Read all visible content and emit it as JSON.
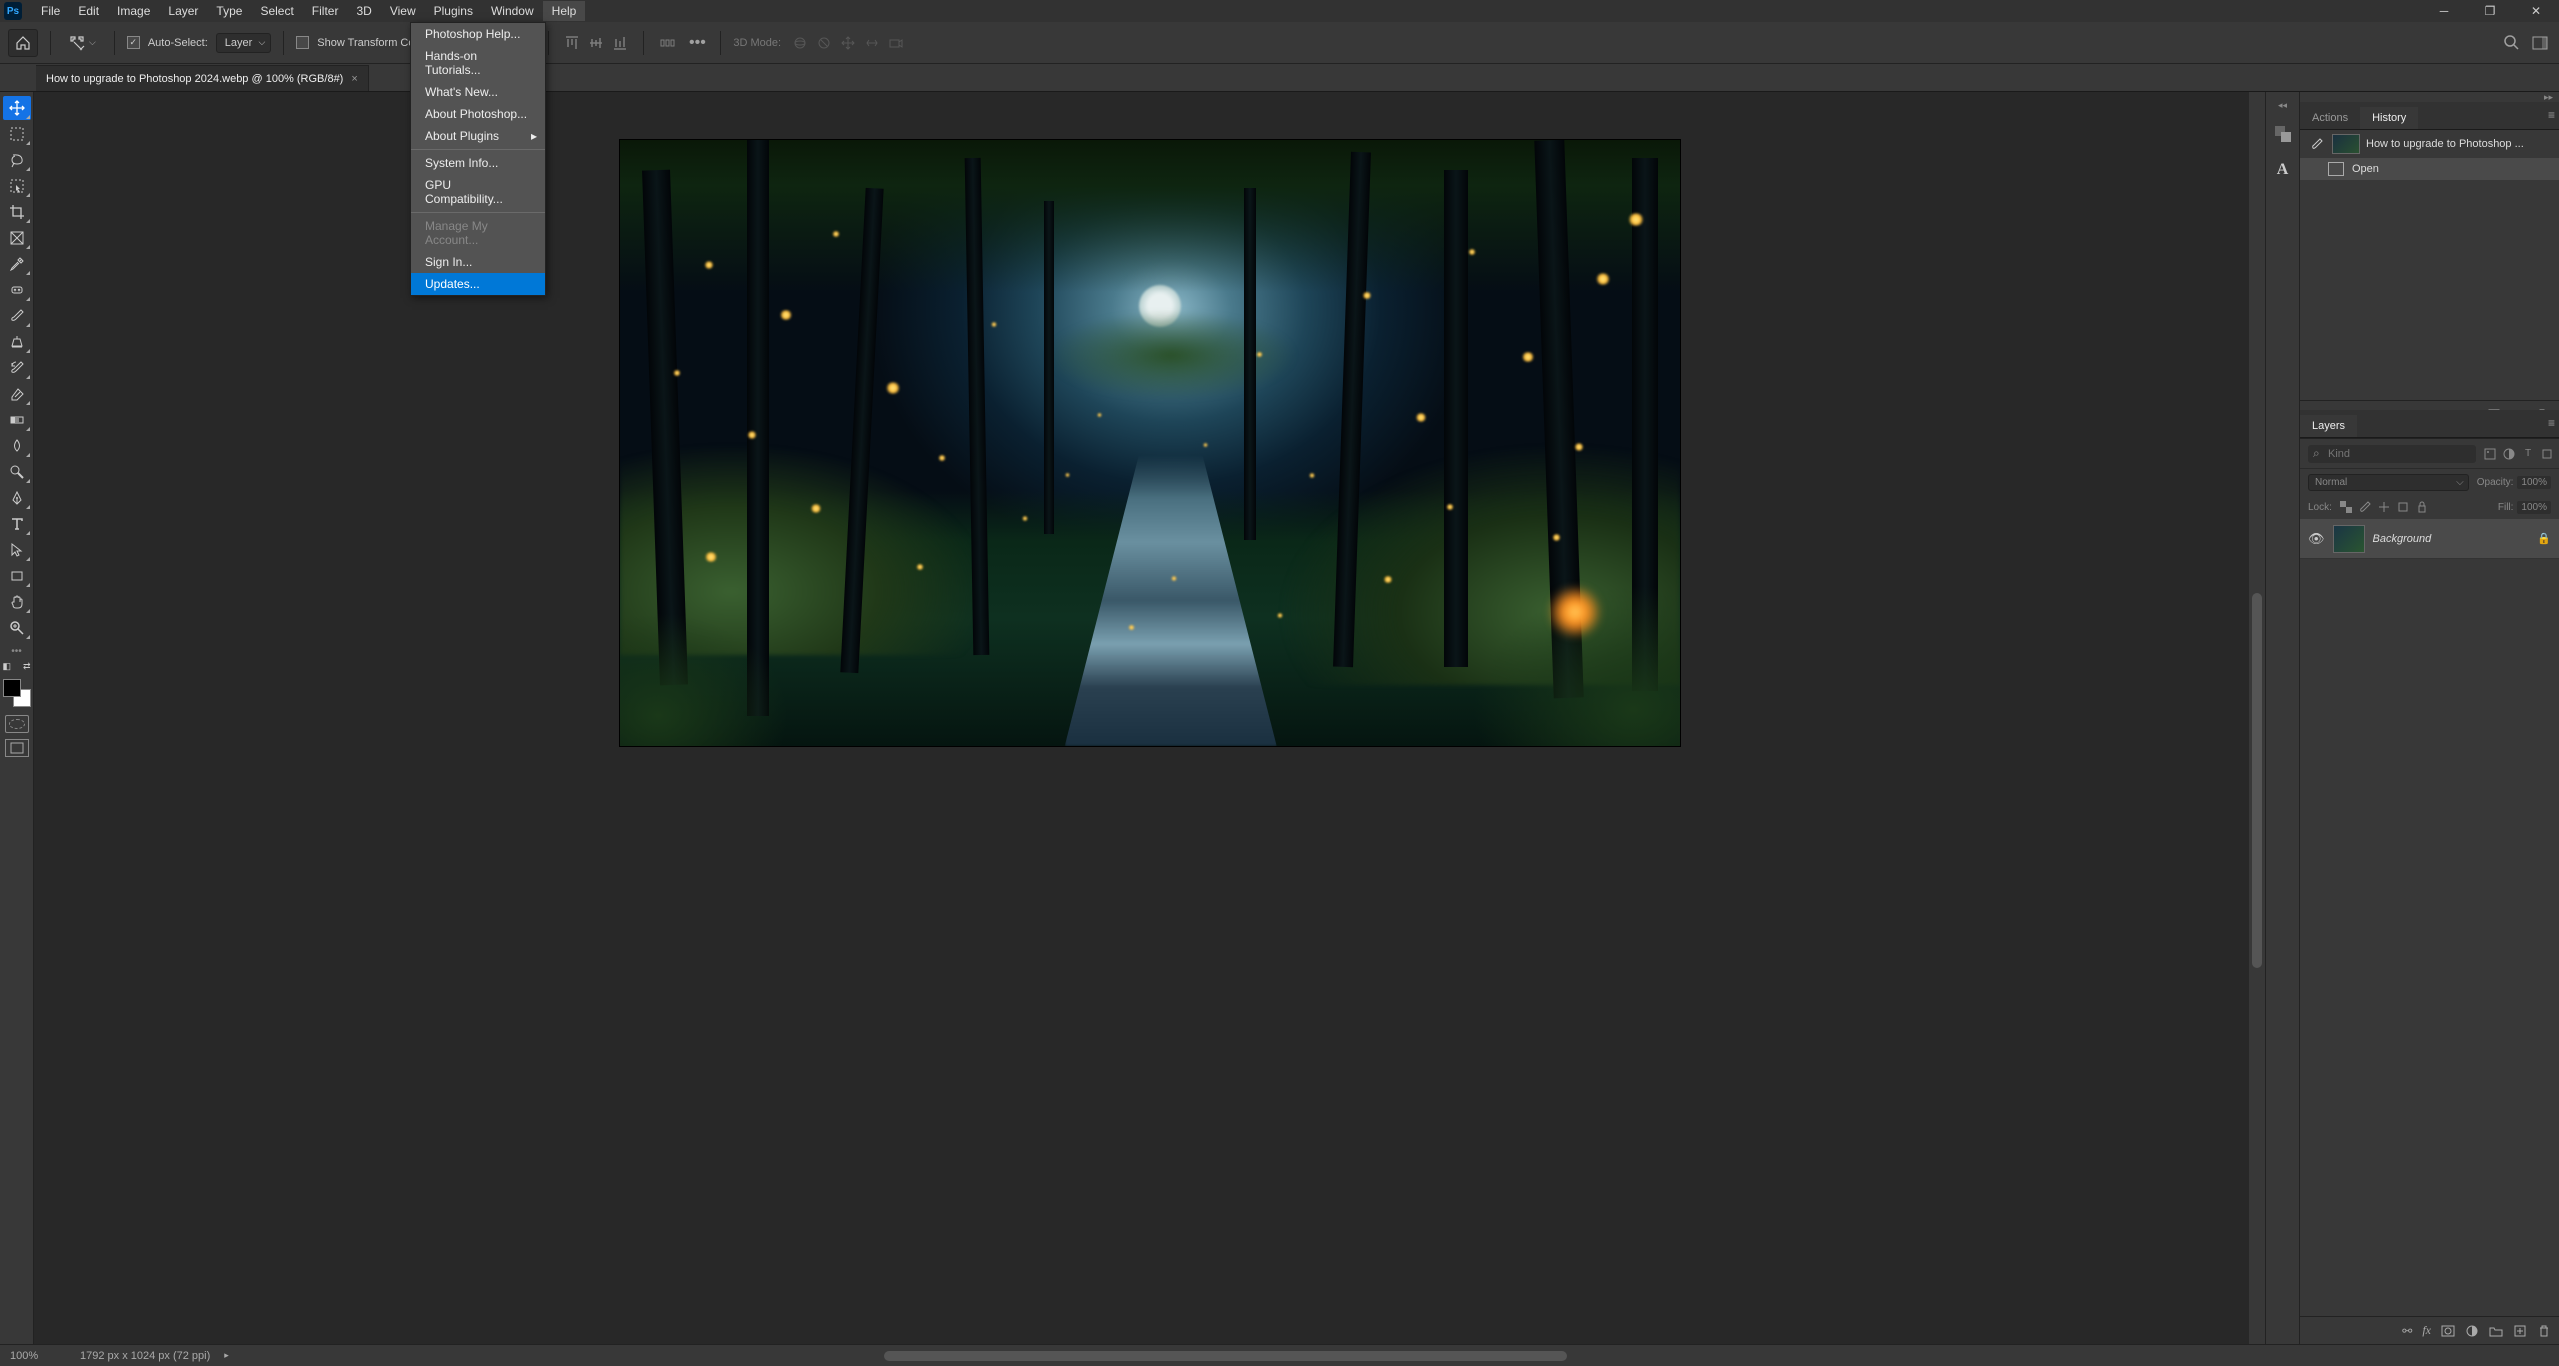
{
  "menubar": [
    "File",
    "Edit",
    "Image",
    "Layer",
    "Type",
    "Select",
    "Filter",
    "3D",
    "View",
    "Plugins",
    "Window",
    "Help"
  ],
  "active_menu_index": 11,
  "dropdown": {
    "groups": [
      [
        "Photoshop Help...",
        "Hands-on Tutorials...",
        "What's New...",
        "About Photoshop...",
        "About Plugins"
      ],
      [
        "System Info...",
        "GPU Compatibility..."
      ],
      [
        "Manage My Account...",
        "Sign In...",
        "Updates..."
      ]
    ],
    "submenu_items": [
      "About Plugins"
    ],
    "disabled_items": [
      "Manage My Account..."
    ],
    "highlighted": "Updates..."
  },
  "options": {
    "auto_select_label": "Auto-Select:",
    "auto_select_checked": true,
    "target": "Layer",
    "show_transform_label": "Show Transform Controls",
    "show_transform_checked": false,
    "mode_3d_label": "3D Mode:"
  },
  "document": {
    "tab_title": "How to upgrade to Photoshop 2024.webp @ 100% (RGB/8#)"
  },
  "history": {
    "tabs": [
      "Actions",
      "History"
    ],
    "active_tab": 1,
    "doc_title": "How to upgrade to Photoshop ...",
    "states": [
      {
        "label": "Open"
      }
    ]
  },
  "layers": {
    "tab": "Layers",
    "filter_placeholder": "Kind",
    "blend_mode": "Normal",
    "opacity_label": "Opacity:",
    "opacity_value": "100%",
    "lock_label": "Lock:",
    "fill_label": "Fill:",
    "fill_value": "100%",
    "items": [
      {
        "name": "Background",
        "locked": true
      }
    ]
  },
  "status": {
    "zoom": "100%",
    "doc_info": "1792 px x 1024 px (72 ppi)"
  },
  "toolbar_tools": [
    "move",
    "marquee",
    "lasso",
    "wand",
    "crop",
    "frame",
    "eyedropper",
    "spot-heal",
    "brush",
    "clone",
    "history-brush",
    "eraser",
    "gradient",
    "blur",
    "dodge",
    "pen",
    "type",
    "path-select",
    "rectangle",
    "hand",
    "zoom"
  ]
}
